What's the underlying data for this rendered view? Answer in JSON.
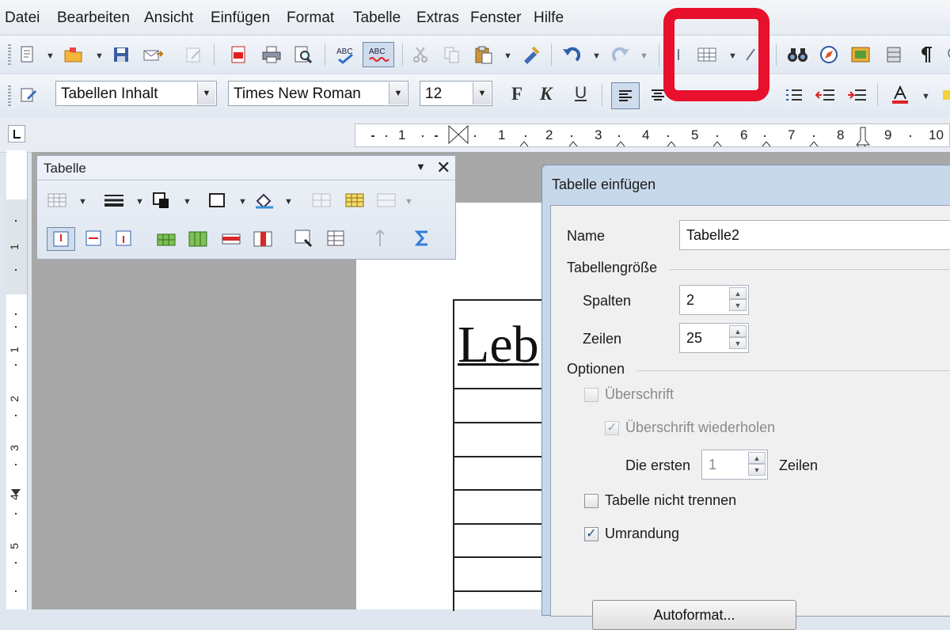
{
  "menu": [
    "Datei",
    "Bearbeiten",
    "Ansicht",
    "Einfügen",
    "Format",
    "Tabelle",
    "Extras",
    "Fenster",
    "Hilfe"
  ],
  "formatting": {
    "paragraph_style": "Tabellen Inhalt",
    "font_name": "Times New Roman",
    "font_size": "12",
    "bold_label": "F",
    "italic_label": "K",
    "underline_label": "U"
  },
  "ruler": {
    "numbers": [
      "1",
      "1",
      "2",
      "3",
      "4",
      "5",
      "6",
      "7",
      "8",
      "9",
      "10"
    ],
    "vertical_numbers": [
      "1",
      "1",
      "2",
      "3",
      "4",
      "5"
    ]
  },
  "document": {
    "heading_fragment": "Leb"
  },
  "table_toolbar": {
    "title": "Tabelle"
  },
  "dialog": {
    "title": "Tabelle einfügen",
    "name_label": "Name",
    "name_value": "Tabelle2",
    "size_group": "Tabellengröße",
    "columns_label": "Spalten",
    "columns_value": "2",
    "rows_label": "Zeilen",
    "rows_value": "25",
    "options_group": "Optionen",
    "heading_label": "Überschrift",
    "heading_checked": false,
    "repeat_heading_label": "Überschrift wiederholen",
    "repeat_heading_checked": true,
    "first_label": "Die ersten",
    "first_value": "1",
    "first_unit": "Zeilen",
    "no_split_label": "Tabelle nicht trennen",
    "no_split_checked": false,
    "border_label": "Umrandung",
    "border_checked": true,
    "autoformat_label": "Autoformat..."
  },
  "colors": {
    "highlight": "#e8102c",
    "toolbar": "#e6ebf2",
    "dialog_frame": "#c7d8ea"
  },
  "icons": [
    "new-icon",
    "open-icon",
    "save-icon",
    "email-icon",
    "edit-doc-icon",
    "pdf-icon",
    "print-icon",
    "print-preview-icon",
    "spellcheck-icon",
    "autospellcheck-icon",
    "cut-icon",
    "copy-icon",
    "paste-icon",
    "clone-format-icon",
    "undo-icon",
    "redo-icon",
    "hyperlink-icon",
    "insert-table-icon",
    "show-draw-icon",
    "find-replace-icon",
    "navigator-icon",
    "gallery-icon",
    "data-sources-icon",
    "formatting-marks-icon"
  ]
}
